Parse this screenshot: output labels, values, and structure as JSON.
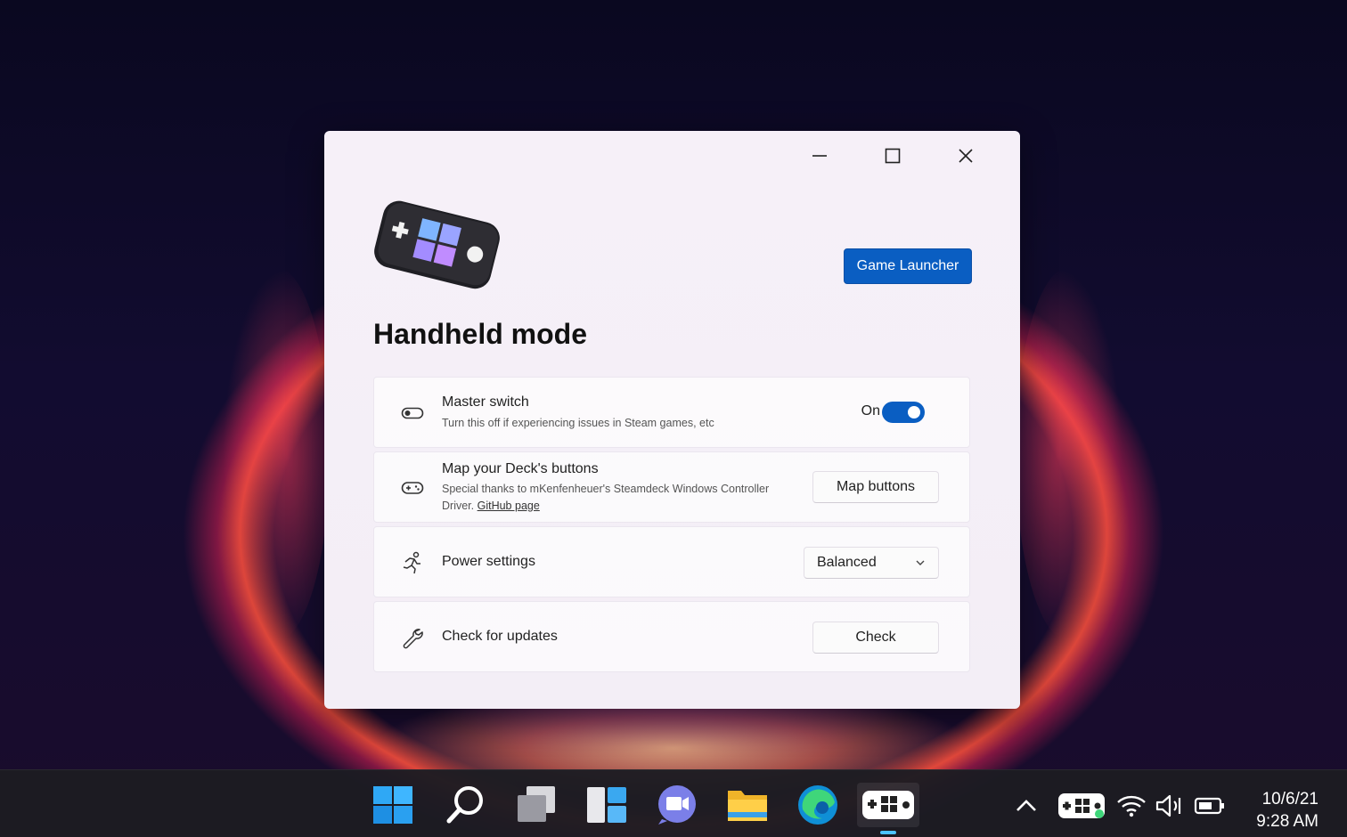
{
  "window": {
    "title": "Handheld mode",
    "game_launcher_label": "Game Launcher"
  },
  "settings": {
    "master": {
      "title": "Master switch",
      "description": "Turn this off if experiencing issues in Steam games, etc",
      "state_label": "On",
      "enabled": true
    },
    "map": {
      "title": "Map your Deck's buttons",
      "description": "Special thanks to mKenfenheuer's Steamdeck Windows Controller Driver.",
      "link": "GitHub page",
      "button_label": "Map buttons"
    },
    "power": {
      "title": "Power settings",
      "selected": "Balanced"
    },
    "updates": {
      "title": "Check for updates",
      "button_label": "Check"
    }
  },
  "taskbar": {
    "date": "10/6/21",
    "time": "9:28 AM"
  },
  "colors": {
    "accent": "#0a5ec2",
    "taskbar_indicator": "#4cc2ff"
  }
}
